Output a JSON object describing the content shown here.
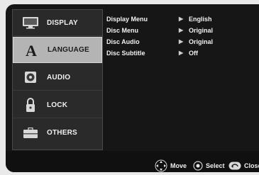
{
  "menu": {
    "items": [
      {
        "label": "DISPLAY",
        "icon": "display-icon"
      },
      {
        "label": "LANGUAGE",
        "icon": "language-icon"
      },
      {
        "label": "AUDIO",
        "icon": "audio-icon"
      },
      {
        "label": "LOCK",
        "icon": "lock-icon"
      },
      {
        "label": "OTHERS",
        "icon": "others-icon"
      }
    ],
    "selected_index": 1
  },
  "settings": [
    {
      "name": "Display Menu",
      "value": "English"
    },
    {
      "name": "Disc Menu",
      "value": "Original"
    },
    {
      "name": "Disc Audio",
      "value": "Original"
    },
    {
      "name": "Disc Subtitle",
      "value": "Off"
    }
  ],
  "hints": {
    "move": "Move",
    "select": "Select",
    "close": "Close"
  },
  "colors": {
    "background": "#161616",
    "menu_panel": "#2a2a2a",
    "selected_item": "#b4b4b4",
    "text": "#f2f2f2"
  }
}
